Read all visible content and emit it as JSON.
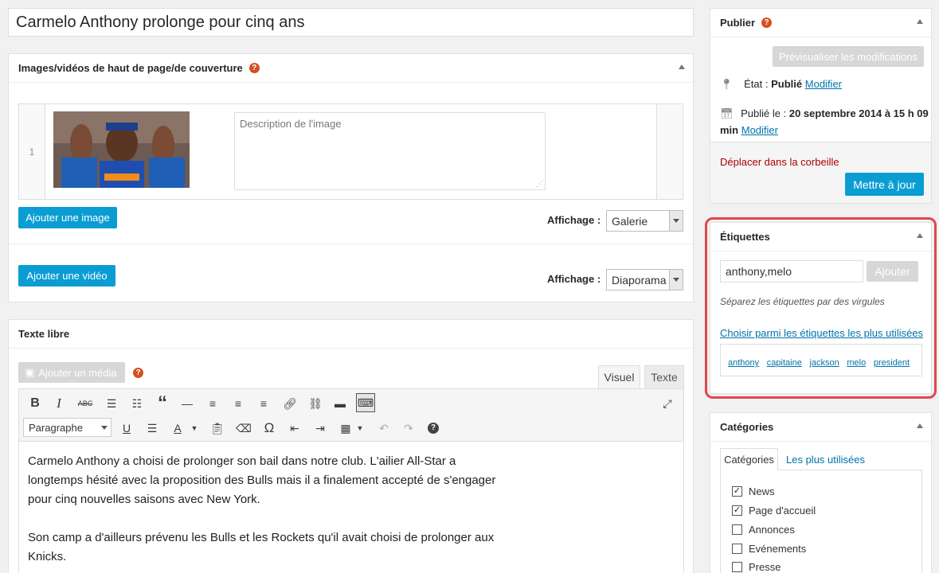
{
  "post_title": "Carmelo Anthony prolonge pour cinq ans",
  "media_box": {
    "title": "Images/vidéos de haut de page/de couverture",
    "row_number": "1",
    "image_desc_placeholder": "Description de l'image",
    "add_image_label": "Ajouter une image",
    "add_video_label": "Ajouter une vidéo",
    "display_label": "Affichage :",
    "image_display_value": "Galerie",
    "video_display_value": "Diaporama"
  },
  "text_box": {
    "title": "Texte libre",
    "add_media_label": "Ajouter un média",
    "tab_visual": "Visuel",
    "tab_text": "Texte",
    "format_value": "Paragraphe",
    "paragraph1_lines": [
      "Carmelo Anthony a choisi de prolonger son bail dans notre club. L'ailier All-Star a",
      "longtemps hésité avec la proposition des Bulls mais il a finalement accepté de s'engager",
      "pour cinq nouvelles saisons avec New York."
    ],
    "paragraph2_lines": [
      "Son camp a d'ailleurs prévenu les Bulls et les Rockets qu'il avait choisi de prolonger aux",
      "Knicks."
    ]
  },
  "publish_box": {
    "title": "Publier",
    "preview_label": "Prévisualiser les modifications",
    "status_label": "État :",
    "status_value": "Publié",
    "status_edit": "Modifier",
    "published_label": "Publié le :",
    "published_value": "20 septembre 2014 à 15 h 09",
    "published_suffix": "min",
    "published_edit": "Modifier",
    "trash_label": "Déplacer dans la corbeille",
    "update_label": "Mettre à jour"
  },
  "tags_box": {
    "title": "Étiquettes",
    "input_value": "anthony,melo",
    "add_label": "Ajouter",
    "hint": "Séparez les étiquettes par des virgules",
    "choose_label": "Choisir parmi les étiquettes les plus utilisées",
    "tags": [
      "anthony",
      "capitaine",
      "jackson",
      "melo",
      "president"
    ]
  },
  "categories_box": {
    "title": "Catégories",
    "tab_all": "Catégories",
    "tab_popular": "Les plus utilisées",
    "items": [
      {
        "label": "News",
        "checked": "✓"
      },
      {
        "label": "Page d'accueil",
        "checked": "✓"
      },
      {
        "label": "Annonces",
        "checked": ""
      },
      {
        "label": "Evénements",
        "checked": ""
      },
      {
        "label": "Presse",
        "checked": ""
      }
    ]
  },
  "colors": {
    "accent_blue": "#0a9dd3",
    "highlight_red": "#e0474c",
    "trash_red": "#a00"
  }
}
